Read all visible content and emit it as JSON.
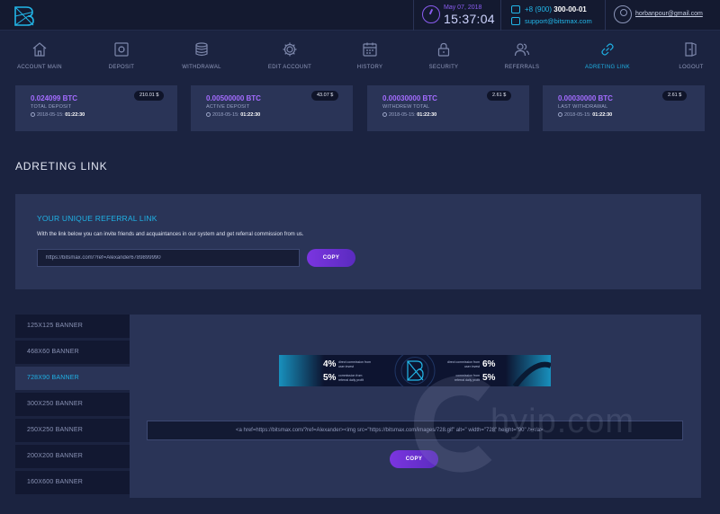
{
  "topbar": {
    "date": "May 07, 2018",
    "time": "15:37:04",
    "phone_prefix": "+8 (900)",
    "phone_number": "300-00-01",
    "email": "support@bitsmax.com",
    "username": "horbanpour@gmail.com"
  },
  "nav": [
    {
      "label": "ACCOUNT MAIN",
      "icon": "home-icon"
    },
    {
      "label": "DEPOSIT",
      "icon": "safe-icon"
    },
    {
      "label": "WITHDRAWAL",
      "icon": "coins-icon"
    },
    {
      "label": "EDIT ACCOUNT",
      "icon": "gear-icon"
    },
    {
      "label": "HISTORY",
      "icon": "calendar-icon"
    },
    {
      "label": "SECURITY",
      "icon": "lock-icon"
    },
    {
      "label": "REFERRALS",
      "icon": "users-icon"
    },
    {
      "label": "ADRETING LINK",
      "icon": "link-icon",
      "active": true
    },
    {
      "label": "LOGOUT",
      "icon": "logout-icon"
    }
  ],
  "cards": [
    {
      "amount": "0.024099 BTC",
      "label": "TOTAL DEPOSIT",
      "date": "2018-05-15:",
      "time": "01:22:30",
      "badge": "210.01 $"
    },
    {
      "amount": "0.00500000 BTC",
      "label": "ACTIVE DEPOSIT",
      "date": "2018-05-15:",
      "time": "01:22:30",
      "badge": "43.07 $"
    },
    {
      "amount": "0.00030000 BTC",
      "label": "WITHDREW TOTAL",
      "date": "2018-05-15:",
      "time": "01:22:30",
      "badge": "2.61 $"
    },
    {
      "amount": "0.00030000 BTC",
      "label": "LAST WITHDRAWAL",
      "date": "2018-05-15:",
      "time": "01:22:30",
      "badge": "2.61 $"
    }
  ],
  "page_title": "ADRETING LINK",
  "referral": {
    "title": "YOUR UNIQUE REFERRAL LINK",
    "description": "With the link below you can invite friends and acquaintances in our system and get referral commission from us.",
    "link_value": "https://bitsmax.com/?ref=Alexander6789899990",
    "copy_label": "COPY"
  },
  "banners": {
    "tabs": [
      "125X125 BANNER",
      "468X60 BANNER",
      "728X90 BANNER",
      "300X250 BANNER",
      "250X250 BANNER",
      "200X200 BANNER",
      "160X600 BANNER"
    ],
    "active_index": 2,
    "preview": {
      "pct1": "4%",
      "text1": "direct commission from user invest",
      "pct2": "5%",
      "text2": "commission from referral daily profit",
      "pct3": "6%",
      "text3": "direct commission from user invest",
      "pct4": "5%",
      "text4": "commission from referral daily profit"
    },
    "code": "<a href=https://bitsmax.com/?ref=Alexander><img src=\"https://bitsmax.com/images/728.gif\" alt=\" width=\"728\" height=\"90\" /></a>",
    "copy_label": "COPY"
  },
  "watermark": "hyip.com",
  "colors": {
    "accent": "#1fb2e6",
    "purple": "#a46cff",
    "panel": "#2a3457",
    "bg": "#1b2340"
  }
}
